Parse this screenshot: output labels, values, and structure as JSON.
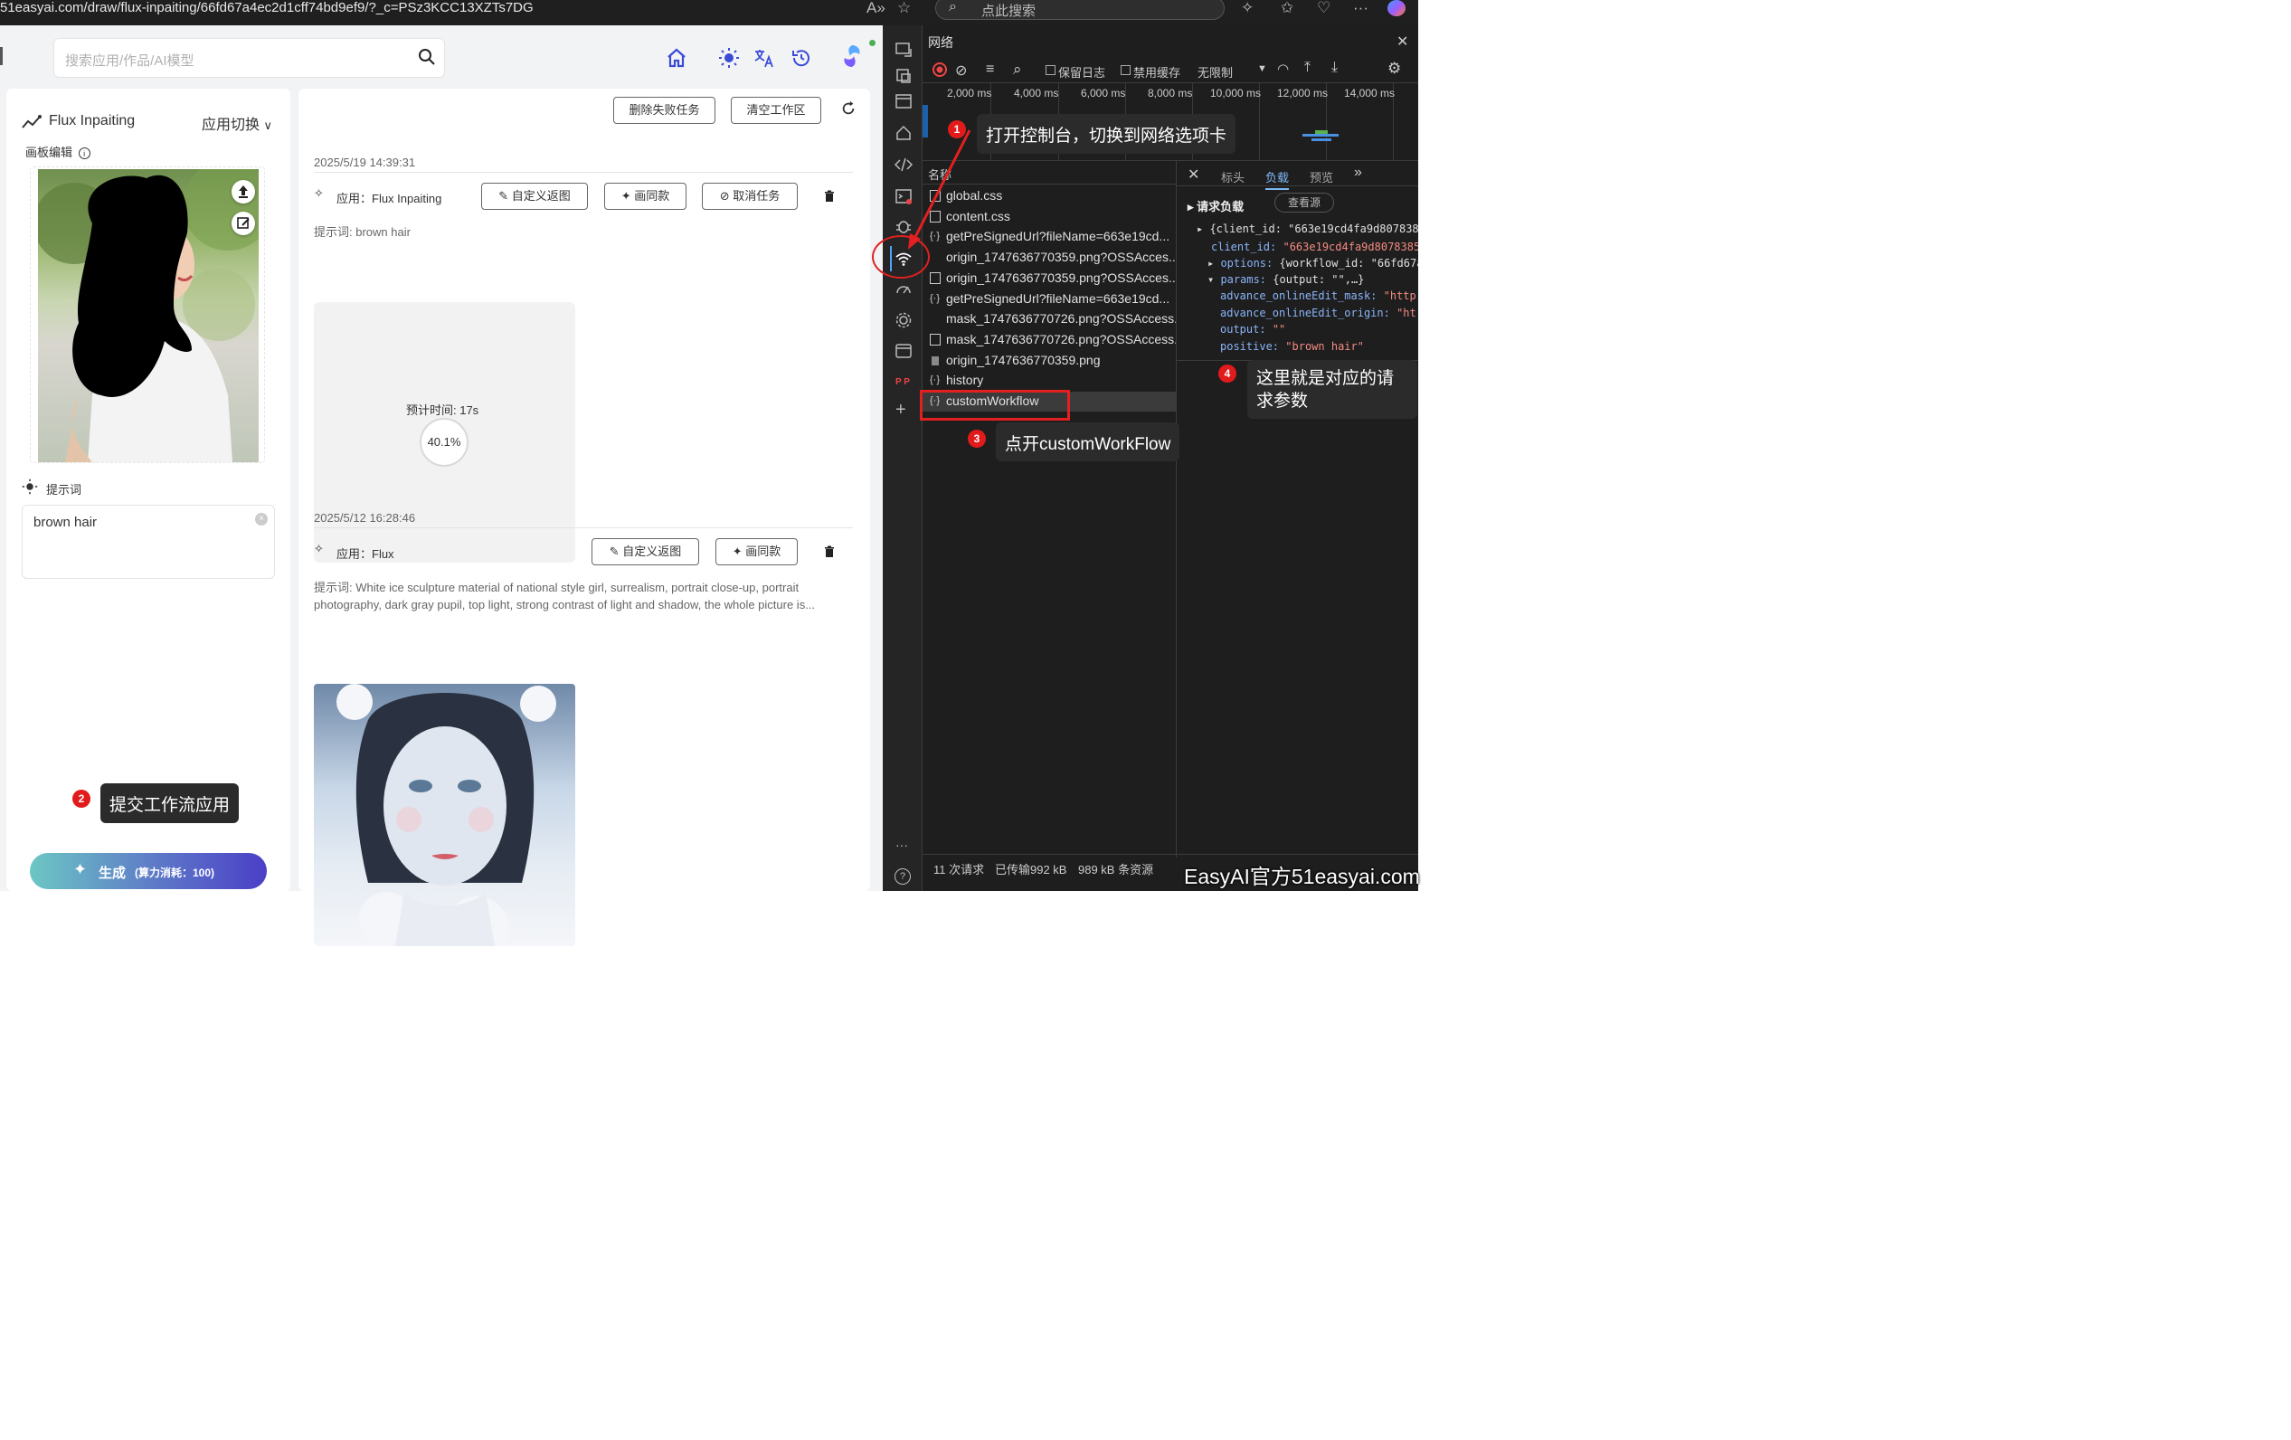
{
  "browser": {
    "url": "51easyai.com/draw/flux-inpaiting/66fd67a4ec2d1cff74bd9ef9/?_c=PSz3KCC13XZTs7DG",
    "search_placeholder": "点此搜索"
  },
  "app": {
    "search_placeholder": "搜索应用/作品/AI模型",
    "left": {
      "app_title": "Flux Inpaiting",
      "switch_label": "应用切换",
      "canvas_label": "画板编辑",
      "prompt_label": "提示词",
      "prompt_value": "brown hair",
      "generate_label": "生成",
      "generate_cost": "(算力消耗：100)"
    },
    "right": {
      "delete_failed": "删除失败任务",
      "clear_workspace": "清空工作区",
      "tasks": [
        {
          "time": "2025/5/19 14:39:31",
          "app": "应用：Flux Inpaiting",
          "btn_custom": "自定义返图",
          "btn_same": "画同款",
          "btn_cancel": "取消任务",
          "prompt": "提示词: brown hair",
          "eta": "预计时间: 17s",
          "progress": "40.1%"
        },
        {
          "time": "2025/5/12 16:28:46",
          "app": "应用：Flux",
          "btn_custom": "自定义返图",
          "btn_same": "画同款",
          "prompt_line1": "提示词: White ice sculpture material of national style girl, surrealism, portrait close-up, portrait",
          "prompt_line2": "photography, dark gray pupil, top light, strong contrast of light and shadow, the whole picture is..."
        }
      ]
    }
  },
  "devtools": {
    "panel_title": "网络",
    "toolbar": {
      "preserve_log": "保留日志",
      "disable_cache": "禁用缓存",
      "throttle": "无限制"
    },
    "timeline_labels": [
      "2,000 ms",
      "4,000 ms",
      "6,000 ms",
      "8,000 ms",
      "10,000 ms",
      "12,000 ms",
      "14,000 ms"
    ],
    "list_header": "名称",
    "requests": [
      {
        "icon": "css",
        "name": "global.css"
      },
      {
        "icon": "css",
        "name": "content.css"
      },
      {
        "icon": "fetch",
        "name": "getPreSignedUrl?fileName=663e19cd..."
      },
      {
        "icon": "none",
        "name": "origin_1747636770359.png?OSSAcces..."
      },
      {
        "icon": "doc",
        "name": "origin_1747636770359.png?OSSAcces..."
      },
      {
        "icon": "fetch",
        "name": "getPreSignedUrl?fileName=663e19cd..."
      },
      {
        "icon": "none",
        "name": "mask_1747636770726.png?OSSAccess..."
      },
      {
        "icon": "doc",
        "name": "mask_1747636770726.png?OSSAccess..."
      },
      {
        "icon": "img",
        "name": "origin_1747636770359.png"
      },
      {
        "icon": "fetch",
        "name": "history"
      },
      {
        "icon": "fetch",
        "name": "customWorkflow"
      }
    ],
    "detail_tabs": [
      "标头",
      "负载",
      "预览"
    ],
    "active_tab": "负载",
    "payload": {
      "section": "请求负载",
      "view_source": "查看源",
      "root": "{client_id: \"663e19cd4fa9d807838",
      "client_id_key": "client_id:",
      "client_id_val": "\"663e19cd4fa9d8078385",
      "options_key": "options:",
      "options_val": "{workflow_id: \"66fd67a",
      "params_key": "params:",
      "params_val": "{output: \"\",…}",
      "mask_key": "advance_onlineEdit_mask:",
      "mask_val": "\"http",
      "origin_key": "advance_onlineEdit_origin:",
      "origin_val": "\"ht",
      "output_key": "output:",
      "output_val": "\"\"",
      "positive_key": "positive:",
      "positive_val": "\"brown hair\""
    },
    "status": {
      "requests": "11 次请求",
      "transferred": "已传输992 kB",
      "resources": "989 kB 条资源"
    }
  },
  "annotations": {
    "step1": "打开控制台，切换到网络选项卡",
    "step2": "提交工作流应用",
    "step3": "点开customWorkFlow",
    "step4_line1": "这里就是对应的请",
    "step4_line2": "求参数",
    "n1": "1",
    "n2": "2",
    "n3": "3",
    "n4": "4",
    "watermark": "EasyAI官方51easyai.com",
    "color": "#e32020"
  }
}
